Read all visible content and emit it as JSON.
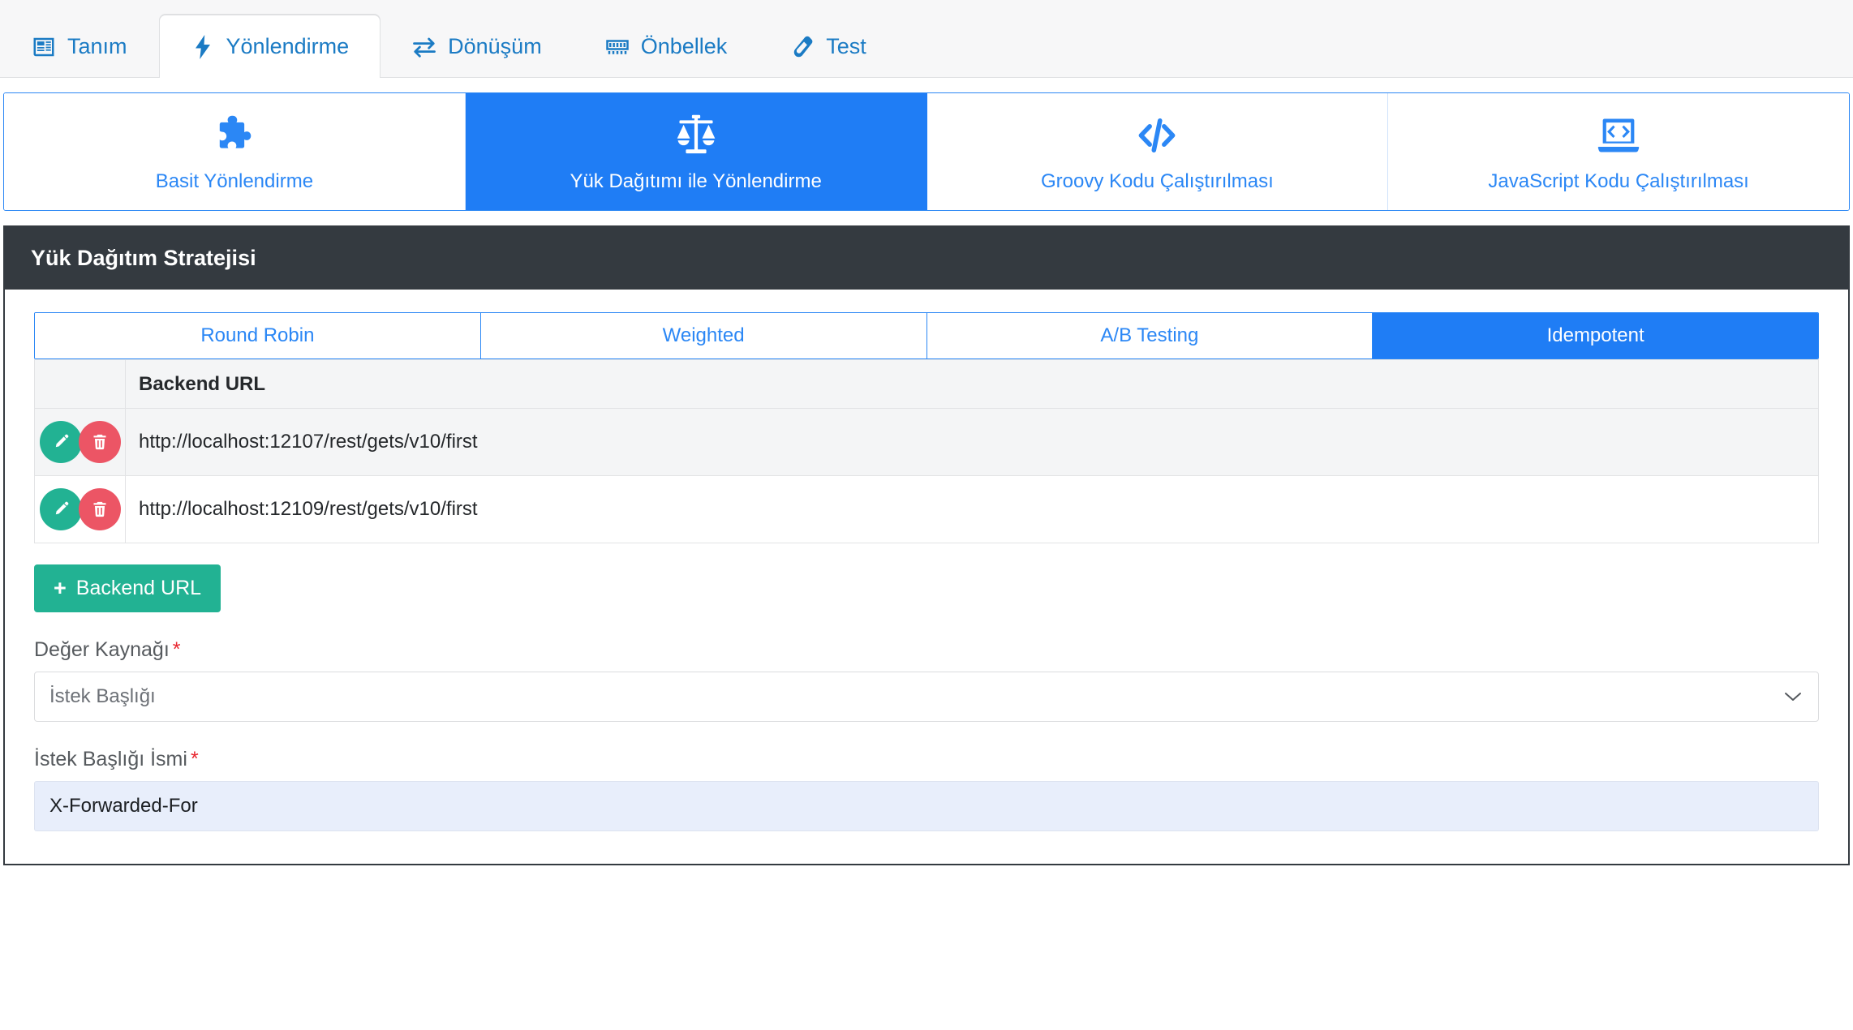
{
  "nav": {
    "tabs": [
      {
        "label": "Tanım",
        "icon": "newspaper-icon",
        "active": false
      },
      {
        "label": "Yönlendirme",
        "icon": "bolt-icon",
        "active": true
      },
      {
        "label": "Dönüşüm",
        "icon": "exchange-arrows-icon",
        "active": false
      },
      {
        "label": "Önbellek",
        "icon": "memory-chip-icon",
        "active": false
      },
      {
        "label": "Test",
        "icon": "test-tube-icon",
        "active": false
      }
    ]
  },
  "methods": {
    "cards": [
      {
        "label": "Basit Yönlendirme",
        "icon": "puzzle-piece-icon",
        "active": false
      },
      {
        "label": "Yük Dağıtımı ile Yönlendirme",
        "icon": "balance-scale-icon",
        "active": true
      },
      {
        "label": "Groovy Kodu Çalıştırılması",
        "icon": "code-slash-icon",
        "active": false
      },
      {
        "label": "JavaScript Kodu Çalıştırılması",
        "icon": "laptop-code-icon",
        "active": false
      }
    ]
  },
  "panel": {
    "title": "Yük Dağıtım Stratejisi",
    "strategies": [
      {
        "label": "Round Robin",
        "active": false
      },
      {
        "label": "Weighted",
        "active": false
      },
      {
        "label": "A/B Testing",
        "active": false
      },
      {
        "label": "Idempotent",
        "active": true
      }
    ],
    "table": {
      "headers": {
        "actions": "",
        "url": "Backend URL"
      },
      "rows": [
        {
          "url": "http://localhost:12107/rest/gets/v10/first",
          "edit": "edit-icon",
          "delete": "trash-icon"
        },
        {
          "url": "http://localhost:12109/rest/gets/v10/first",
          "edit": "edit-icon",
          "delete": "trash-icon"
        }
      ]
    },
    "add_button": {
      "plus": "+",
      "label": "Backend URL"
    },
    "fields": [
      {
        "label": "Değer Kaynağı",
        "required": "*",
        "type": "select",
        "value": "İstek Başlığı",
        "chevron": "chevron-down-icon"
      },
      {
        "label": "İstek Başlığı İsmi",
        "required": "*",
        "type": "text",
        "value": "X-Forwarded-For"
      }
    ]
  },
  "colors": {
    "accent_blue": "#1f7df5",
    "link_blue": "#2b87f5",
    "nav_blue": "#1b7bc4",
    "dark_header": "#343a40",
    "green": "#22b293",
    "red": "#ec5565",
    "required_red": "#e8262f",
    "input_filled_bg": "#e8eefb"
  }
}
